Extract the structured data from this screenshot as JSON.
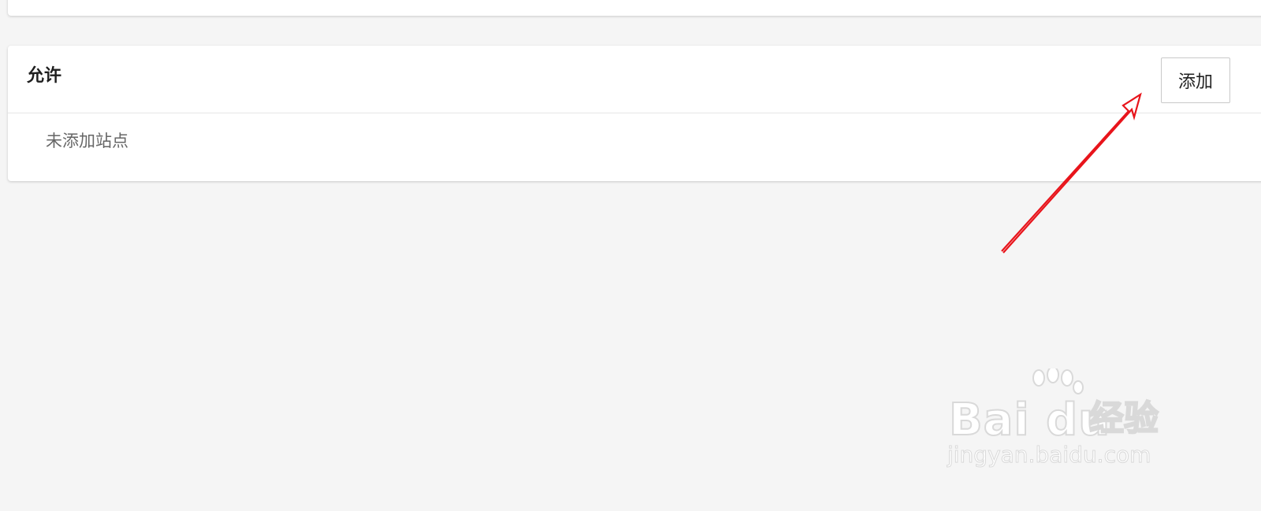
{
  "allow_section": {
    "title": "允许",
    "add_button_label": "添加",
    "empty_message": "未添加站点"
  },
  "watermark": {
    "brand": "Bai du",
    "brand_cn": "经验",
    "url": "jingyan.baidu.com"
  },
  "annotation": {
    "arrow_color": "#e8141b",
    "icon": "red-arrow-pointing-to-add-button"
  }
}
